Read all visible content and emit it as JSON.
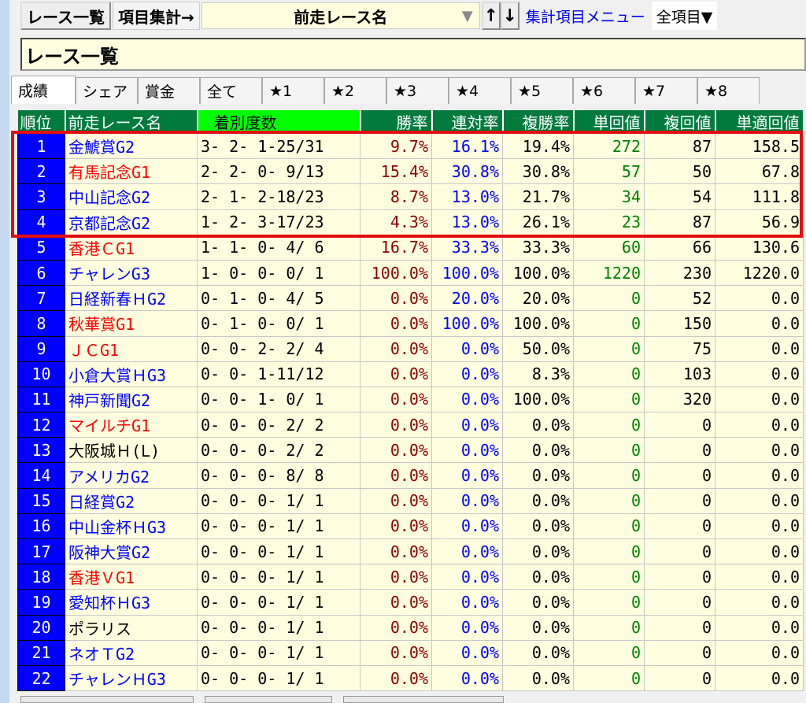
{
  "toolbar": {
    "race_list": "レース一覧",
    "item_agg": "項目集計→",
    "combo_value": "前走レース名",
    "combo_arrow": "▼",
    "up": "↑",
    "down": "↓",
    "menu": "集計項目メニュー",
    "all_items": "全項目▼"
  },
  "title": "レース一覧",
  "tabs": [
    "成績",
    "シェア",
    "賞金",
    "全て",
    "★1",
    "★2",
    "★3",
    "★4",
    "★5",
    "★6",
    "★7",
    "★8"
  ],
  "columns": [
    "順位",
    "前走レース名",
    "着別度数",
    "勝率",
    "連対率",
    "複勝率",
    "単回値",
    "複回値",
    "単適回値"
  ],
  "highlight_color": "#e01010",
  "rows": [
    [
      "1",
      "金鯱賞G2",
      "b",
      "3- 2- 1-25/31",
      "9.7%",
      "16.1%",
      "19.4%",
      "272",
      "87",
      "158.5"
    ],
    [
      "2",
      "有馬記念G1",
      "r",
      "2- 2- 0- 9/13",
      "15.4%",
      "30.8%",
      "30.8%",
      "57",
      "50",
      "67.8"
    ],
    [
      "3",
      "中山記念G2",
      "b",
      "2- 1- 2-18/23",
      "8.7%",
      "13.0%",
      "21.7%",
      "34",
      "54",
      "111.8"
    ],
    [
      "4",
      "京都記念G2",
      "b",
      "1- 2- 3-17/23",
      "4.3%",
      "13.0%",
      "26.1%",
      "23",
      "87",
      "56.9"
    ],
    [
      "5",
      "香港ＣG1",
      "r",
      "1- 1- 0- 4/ 6",
      "16.7%",
      "33.3%",
      "33.3%",
      "60",
      "66",
      "130.6"
    ],
    [
      "6",
      "チャレンG3",
      "b",
      "1- 0- 0- 0/ 1",
      "100.0%",
      "100.0%",
      "100.0%",
      "1220",
      "230",
      "1220.0"
    ],
    [
      "7",
      "日経新春ＨG2",
      "b",
      "0- 1- 0- 4/ 5",
      "0.0%",
      "20.0%",
      "20.0%",
      "0",
      "52",
      "0.0"
    ],
    [
      "8",
      "秋華賞G1",
      "r",
      "0- 1- 0- 0/ 1",
      "0.0%",
      "100.0%",
      "100.0%",
      "0",
      "150",
      "0.0"
    ],
    [
      "9",
      "ＪＣG1",
      "r",
      "0- 0- 2- 2/ 4",
      "0.0%",
      "0.0%",
      "50.0%",
      "0",
      "75",
      "0.0"
    ],
    [
      "10",
      "小倉大賞ＨG3",
      "b",
      "0- 0- 1-11/12",
      "0.0%",
      "0.0%",
      "8.3%",
      "0",
      "103",
      "0.0"
    ],
    [
      "11",
      "神戸新聞G2",
      "b",
      "0- 0- 1- 0/ 1",
      "0.0%",
      "0.0%",
      "100.0%",
      "0",
      "320",
      "0.0"
    ],
    [
      "12",
      "マイルチG1",
      "r",
      "0- 0- 0- 2/ 2",
      "0.0%",
      "0.0%",
      "0.0%",
      "0",
      "0",
      "0.0"
    ],
    [
      "13",
      "大阪城Ｈ(L)",
      "k",
      "0- 0- 0- 2/ 2",
      "0.0%",
      "0.0%",
      "0.0%",
      "0",
      "0",
      "0.0"
    ],
    [
      "14",
      "アメリカG2",
      "b",
      "0- 0- 0- 8/ 8",
      "0.0%",
      "0.0%",
      "0.0%",
      "0",
      "0",
      "0.0"
    ],
    [
      "15",
      "日経賞G2",
      "b",
      "0- 0- 0- 1/ 1",
      "0.0%",
      "0.0%",
      "0.0%",
      "0",
      "0",
      "0.0"
    ],
    [
      "16",
      "中山金杯ＨG3",
      "b",
      "0- 0- 0- 1/ 1",
      "0.0%",
      "0.0%",
      "0.0%",
      "0",
      "0",
      "0.0"
    ],
    [
      "17",
      "阪神大賞G2",
      "b",
      "0- 0- 0- 1/ 1",
      "0.0%",
      "0.0%",
      "0.0%",
      "0",
      "0",
      "0.0"
    ],
    [
      "18",
      "香港ＶG1",
      "r",
      "0- 0- 0- 1/ 1",
      "0.0%",
      "0.0%",
      "0.0%",
      "0",
      "0",
      "0.0"
    ],
    [
      "19",
      "愛知杯ＨG3",
      "b",
      "0- 0- 0- 1/ 1",
      "0.0%",
      "0.0%",
      "0.0%",
      "0",
      "0",
      "0.0"
    ],
    [
      "20",
      "ポラリス",
      "k",
      "0- 0- 0- 1/ 1",
      "0.0%",
      "0.0%",
      "0.0%",
      "0",
      "0",
      "0.0"
    ],
    [
      "21",
      "ネオＴG2",
      "b",
      "0- 0- 0- 1/ 1",
      "0.0%",
      "0.0%",
      "0.0%",
      "0",
      "0",
      "0.0"
    ],
    [
      "22",
      "チャレンＨG3",
      "b",
      "0- 0- 0- 1/ 1",
      "0.0%",
      "0.0%",
      "0.0%",
      "0",
      "0",
      "0.0"
    ]
  ]
}
